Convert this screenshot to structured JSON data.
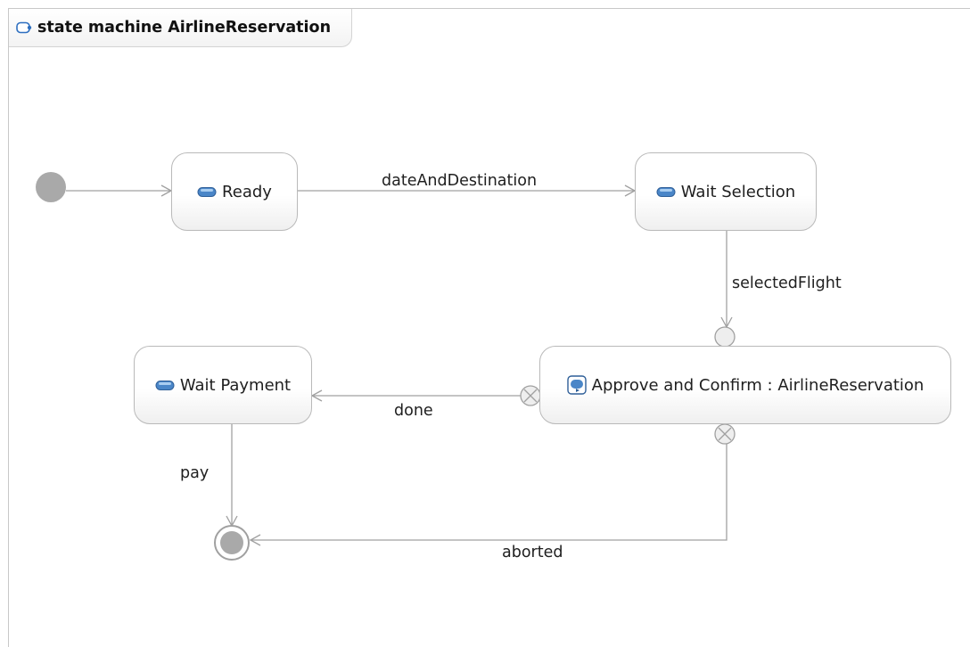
{
  "frame": {
    "title": "state machine AirlineReservation",
    "icon": "state-machine-icon"
  },
  "states": {
    "ready": "Ready",
    "wait_selection": "Wait Selection",
    "approve_confirm": "Approve and Confirm : AirlineReservation",
    "wait_payment": "Wait Payment"
  },
  "transitions": {
    "date_and_destination": "dateAndDestination",
    "selected_flight": "selectedFlight",
    "done": "done",
    "pay": "pay",
    "aborted": "aborted"
  },
  "colors": {
    "node_border": "#b9b9b9",
    "edge": "#a0a0a0",
    "pseudostate_fill": "#a9a9a9",
    "state_icon_blue": "#4a86c8"
  }
}
